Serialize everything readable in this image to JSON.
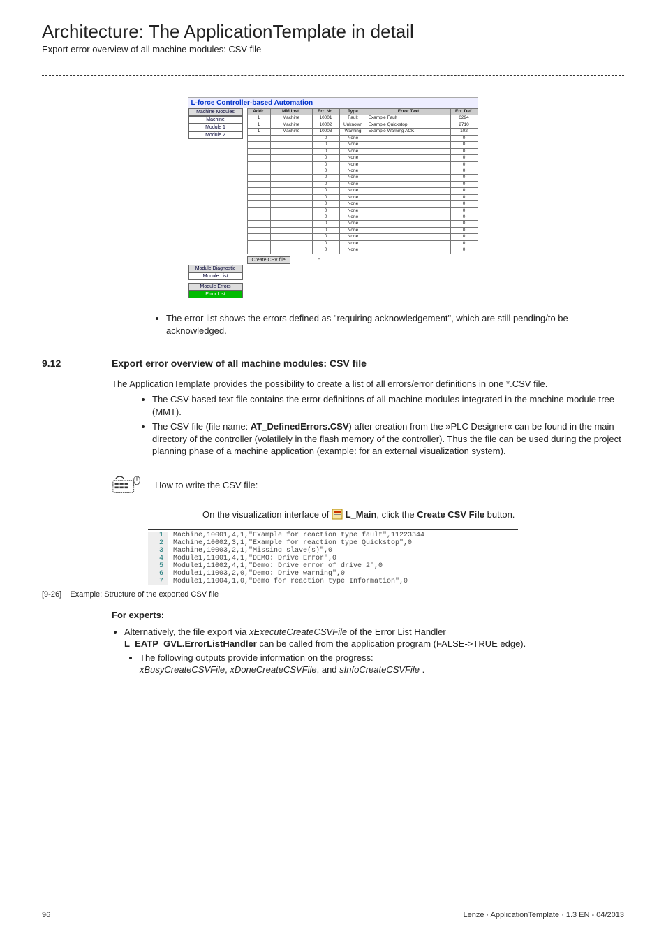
{
  "header": {
    "title": "Architecture: The ApplicationTemplate in detail",
    "subtitle": "Export error overview of all machine modules: CSV file"
  },
  "vis": {
    "title": "L-force Controller-based Automation",
    "left": {
      "mm_title": "Machine Modules",
      "mm_items": [
        "Machine",
        "Module 1",
        "Module 2"
      ],
      "grp1_title": "Module Diagnostic",
      "grp1_items": [
        "Module List"
      ],
      "grp2_title": "Module Errors",
      "grp2_active": "Error List"
    },
    "cols": [
      "Addr.",
      "MM Inst.",
      "Err. No.",
      "Type",
      "Error Text",
      "Err. Def."
    ],
    "rows": [
      {
        "addr": "1",
        "inst": "Machine",
        "no": "10001",
        "type": "Fault",
        "txt": "Example Fault",
        "def": "6294"
      },
      {
        "addr": "1",
        "inst": "Machine",
        "no": "10002",
        "type": "Unknown",
        "txt": "Example Quickstop",
        "def": "2710"
      },
      {
        "addr": "1",
        "inst": "Machine",
        "no": "10003",
        "type": "Warning",
        "txt": "Example Warning ACK",
        "def": "102"
      }
    ],
    "empty_rows": 18,
    "create_btn": "Create CSV file",
    "sep": "-"
  },
  "bullet_pending": "The error list shows the errors defined as \"requiring acknowledgement\", which are still pending/to be acknowledged.",
  "section": {
    "no": "9.12",
    "title": "Export error overview of all machine modules: CSV file"
  },
  "para_intro": "The ApplicationTemplate provides the possibility to create a list of all errors/error definitions in one *.CSV file.",
  "bullets_main": [
    "The CSV-based text file contains the error definitions of all machine modules integrated in the machine module tree (MMT).",
    ""
  ],
  "bullet2_pre": "The CSV file (file name: ",
  "bullet2_bold": "AT_DefinedErrors.CSV",
  "bullet2_post": ") after creation from the »PLC Designer« can be found in the main directory of the controller (volatilely in the flash memory of the controller). Thus the file can be used during the project planning phase of a machine application (example: for an external visualization system).",
  "howto_label": "How to write the CSV file:",
  "vis_instr_pre": "On the visualization interface of ",
  "vis_instr_lmain": "L_Main",
  "vis_instr_mid": ", click the ",
  "vis_instr_btn": "Create CSV File",
  "vis_instr_post": " button.",
  "code": [
    "Machine,10001,4,1,\"Example for reaction type fault\",11223344",
    "Machine,10002,3,1,\"Example for reaction type Quickstop\",0",
    "Machine,10003,2,1,\"Missing slave(s)\",0",
    "Module1,11001,4,1,\"DEMO: Drive Error\",0",
    "Module1,11002,4,1,\"Demo: Drive error of drive 2\",0",
    "Module1,11003,2,0,\"Demo: Drive warning\",0",
    "Module1,11004,1,0,\"Demo for reaction type Information\",0"
  ],
  "caption_no": "[9-26]",
  "caption_txt": "Example: Structure of the exported CSV file",
  "experts_label": "For experts:",
  "experts_b1_pre": "Alternatively, the file export via ",
  "experts_b1_i1": "xExecuteCreateCSVFile",
  "experts_b1_mid": " of the Error List Handler ",
  "experts_b1_bold": "L_EATP_GVL.ErrorListHandler",
  "experts_b1_post": " can be called from the application program (FALSE->TRUE edge).",
  "experts_sub_pre": "The following outputs provide information on the progress:",
  "experts_sub_i1": "xBusyCreateCSVFile",
  "experts_sub_sep1": ", ",
  "experts_sub_i2": "xDoneCreateCSVFile",
  "experts_sub_sep2": ", and ",
  "experts_sub_i3": "sInfoCreateCSVFile",
  "experts_sub_end": " .",
  "footer": {
    "page": "96",
    "right": "Lenze · ApplicationTemplate · 1.3 EN - 04/2013"
  }
}
